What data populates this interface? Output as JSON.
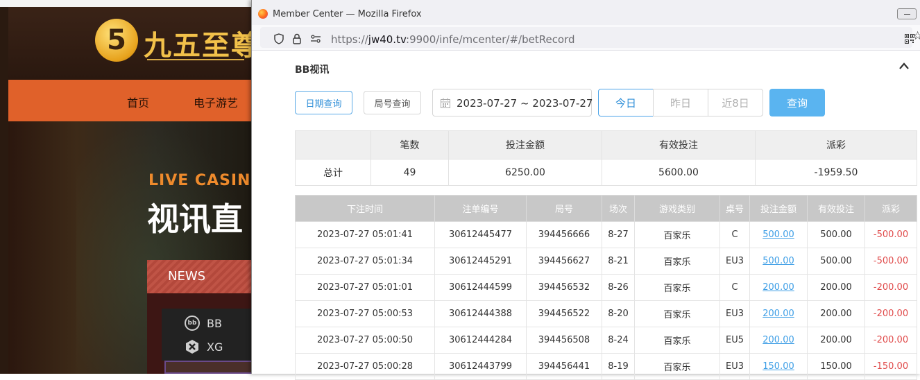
{
  "background_site": {
    "logo_text": "九五至尊",
    "logo_glyph": "5",
    "nav": [
      "首页",
      "电子游艺"
    ],
    "hero_kicker": "LIVE CASINO",
    "hero_title": "视讯直",
    "news_label": "NEWS",
    "providers": [
      {
        "icon": "bb-chip-icon",
        "label": "BB"
      },
      {
        "icon": "xg-icon",
        "label": "XG"
      }
    ]
  },
  "window": {
    "title": "Member Center — Mozilla Firefox",
    "url_host": "jw40.tv",
    "url_prefix": "https://",
    "url_rest": ":9900/infe/mcenter/#/betRecord"
  },
  "page": {
    "section_title": "BB视讯",
    "filters": {
      "date_query": "日期查询",
      "round_query": "局号查询",
      "date_range": "2023-07-27 ~ 2023-07-27",
      "today": "今日",
      "yesterday": "昨日",
      "last8": "近8日",
      "query": "查询"
    },
    "summary": {
      "headers": [
        "",
        "笔数",
        "投注金额",
        "有效投注",
        "派彩"
      ],
      "row": {
        "label": "总计",
        "count": "49",
        "bet": "6250.00",
        "valid": "5600.00",
        "payout": "-1959.50"
      }
    },
    "records": {
      "headers": [
        "下注时间",
        "注单编号",
        "局号",
        "场次",
        "游戏类别",
        "桌号",
        "投注金额",
        "有效投注",
        "派彩"
      ],
      "rows": [
        [
          "2023-07-27 05:01:41",
          "30612445477",
          "394456666",
          "8-27",
          "百家乐",
          "C",
          "500.00",
          "500.00",
          "-500.00"
        ],
        [
          "2023-07-27 05:01:34",
          "30612445291",
          "394456627",
          "8-21",
          "百家乐",
          "EU3",
          "500.00",
          "500.00",
          "-500.00"
        ],
        [
          "2023-07-27 05:01:01",
          "30612444599",
          "394456532",
          "8-26",
          "百家乐",
          "C",
          "200.00",
          "200.00",
          "-200.00"
        ],
        [
          "2023-07-27 05:00:53",
          "30612444388",
          "394456522",
          "8-20",
          "百家乐",
          "EU3",
          "200.00",
          "200.00",
          "-200.00"
        ],
        [
          "2023-07-27 05:00:50",
          "30612444284",
          "394456508",
          "8-24",
          "百家乐",
          "EU5",
          "200.00",
          "200.00",
          "-200.00"
        ],
        [
          "2023-07-27 05:00:28",
          "30612443799",
          "394456441",
          "8-19",
          "百家乐",
          "EU3",
          "150.00",
          "150.00",
          "-150.00"
        ]
      ]
    }
  },
  "colors": {
    "accent": "#2f8fd8",
    "query_button": "#5ab4f0",
    "negative": "#e04a4a",
    "nav_orange": "#e0612a"
  }
}
